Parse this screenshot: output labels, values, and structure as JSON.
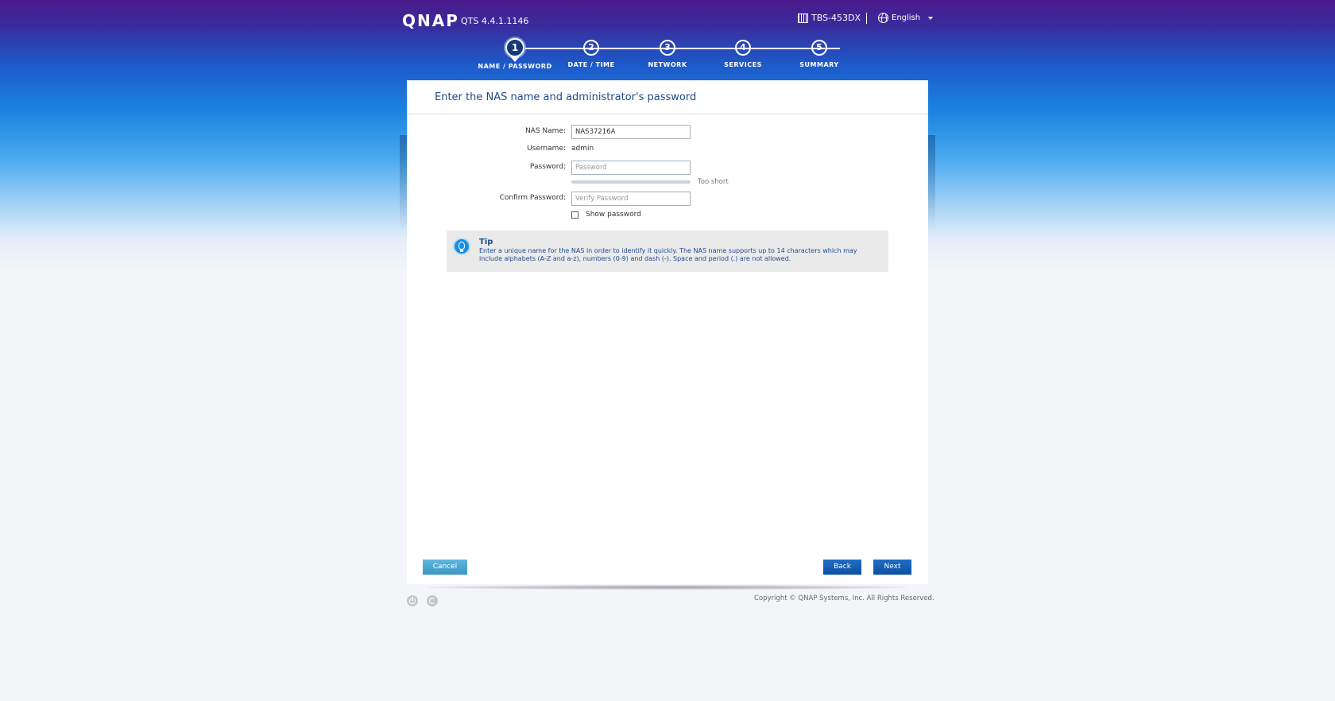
{
  "header": {
    "logo": "QNAP",
    "version": "QTS 4.4.1.1146",
    "model": "TBS-453DX",
    "language": "English"
  },
  "stepper": {
    "current_step": 1,
    "steps": [
      {
        "number": "1",
        "label": "NAME / PASSWORD"
      },
      {
        "number": "2",
        "label": "DATE / TIME"
      },
      {
        "number": "3",
        "label": "NETWORK"
      },
      {
        "number": "4",
        "label": "SERVICES"
      },
      {
        "number": "5",
        "label": "SUMMARY"
      }
    ]
  },
  "panel": {
    "title": "Enter the NAS name and administrator's password"
  },
  "form": {
    "nas_name_label": "NAS Name:",
    "nas_name_value": "NAS37216A",
    "username_label": "Username:",
    "username_value": "admin",
    "password_label": "Password:",
    "password_placeholder": "Password",
    "password_strength_text": "Too short",
    "password_strength_level": 0,
    "confirm_label": "Confirm Password:",
    "confirm_placeholder": "Verify Password",
    "show_password_label": "Show password",
    "show_password_checked": false
  },
  "tip": {
    "title": "Tip",
    "text": "Enter a unique name for the NAS in order to identify it quickly. The NAS name supports up to 14 characters which may include alphabets (A-Z and a-z), numbers (0-9) and dash (-). Space and period (.) are not allowed."
  },
  "buttons": {
    "cancel": "Cancel",
    "back": "Back",
    "next": "Next"
  },
  "footer": {
    "copyright": "Copyright © QNAP Systems, Inc. All Rights Reserved.",
    "icons": [
      "power-icon",
      "restart-icon"
    ]
  },
  "colors": {
    "accent": "#1e4a8c",
    "primary_button": "#0d4ea2",
    "cancel_button": "#3b96c4",
    "tip_background": "#eaeaea"
  }
}
